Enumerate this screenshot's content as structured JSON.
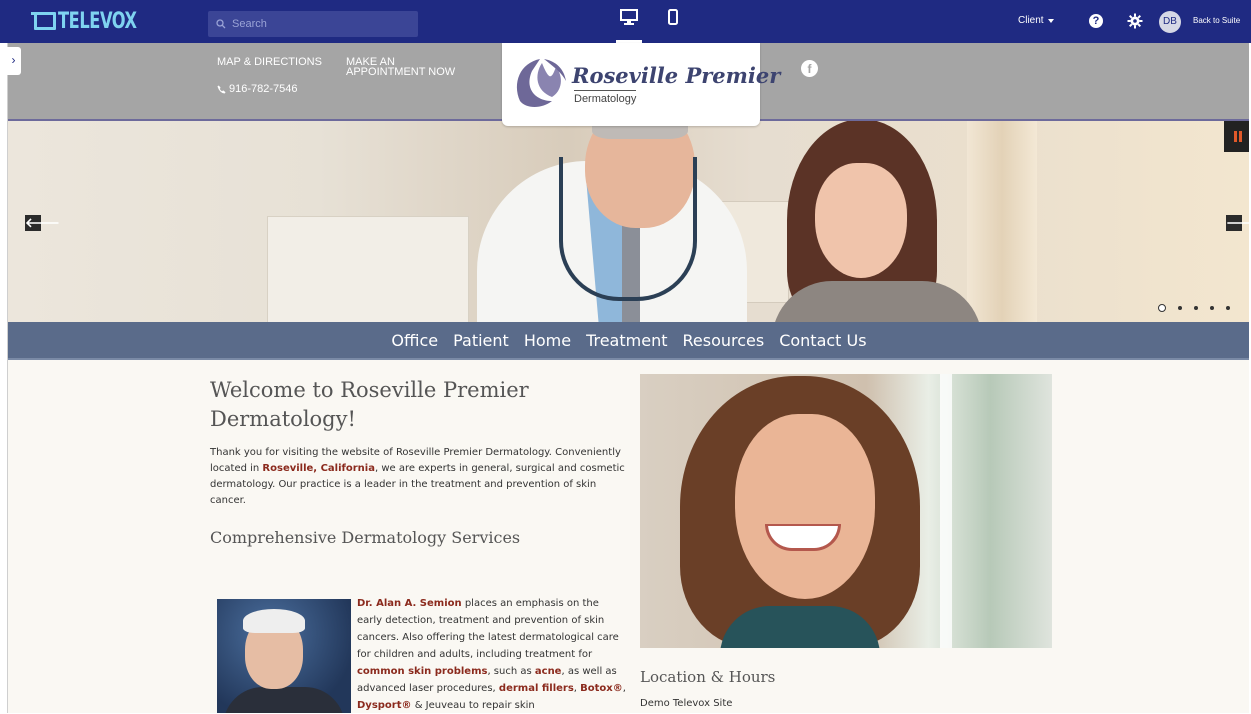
{
  "app": {
    "logo_text": "TELEVOX",
    "search_placeholder": "Search",
    "client_label": "Client",
    "help_label": "?",
    "avatar_initials": "DB",
    "back_label": "Back to Suite",
    "colors": {
      "topbar": "#1f2a82",
      "accent": "#7fd3f0"
    }
  },
  "site_header": {
    "map_link": "MAP & DIRECTIONS",
    "appointment_line1": "MAKE AN",
    "appointment_line2": "APPOINTMENT NOW",
    "phone": "916-782-7546",
    "brand_name": "Roseville Premier",
    "brand_sub": "Dermatology",
    "social_icon": "facebook-icon"
  },
  "hero": {
    "prev_label": "🡐",
    "next_label": "🡒",
    "slides_total": 5,
    "active_slide": 1
  },
  "nav": {
    "items": [
      "Office",
      "Patient",
      "Home",
      "Treatment",
      "Resources",
      "Contact Us"
    ]
  },
  "content": {
    "welcome_title": "Welcome to Roseville Premier Dermatology!",
    "intro_before": "Thank you for visiting the website of Roseville Premier Dermatology. Conveniently located in ",
    "intro_link": "Roseville, California",
    "intro_after": ", we are experts in general, surgical and cosmetic dermatology. Our practice is a leader in the treatment and prevention of skin cancer.",
    "services_heading": "Comprehensive Dermatology Services",
    "bio_name": "Dr. Alan A. Semion",
    "bio_text1": " places an emphasis on the early detection, treatment and prevention of skin cancers. Also offering the latest dermatological care for children and adults, including treatment for ",
    "bio_link1": "common skin problems",
    "bio_text2": ", such as ",
    "bio_link2": "acne",
    "bio_text3": ", as well as advanced laser procedures, ",
    "bio_link3": "dermal fillers",
    "bio_text4": ", ",
    "bio_link4": "Botox®",
    "bio_text5": ", ",
    "bio_link5": "Dysport®",
    "bio_text6": " & Jeuveau to repair skin",
    "location_heading": "Location & Hours",
    "location_sub": "Demo Televox Site"
  }
}
